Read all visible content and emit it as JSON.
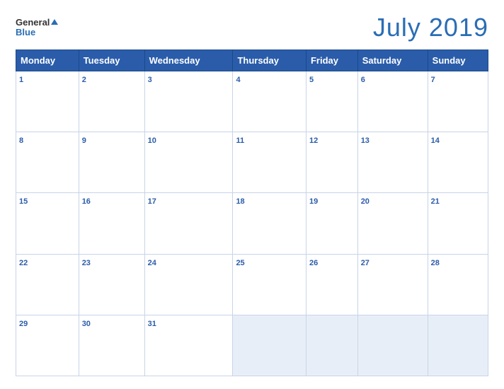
{
  "header": {
    "logo": {
      "general": "General",
      "blue": "Blue"
    },
    "title": "July 2019"
  },
  "calendar": {
    "days": [
      "Monday",
      "Tuesday",
      "Wednesday",
      "Thursday",
      "Friday",
      "Saturday",
      "Sunday"
    ],
    "weeks": [
      {
        "dates": [
          1,
          2,
          3,
          4,
          5,
          6,
          7
        ]
      },
      {
        "dates": [
          8,
          9,
          10,
          11,
          12,
          13,
          14
        ]
      },
      {
        "dates": [
          15,
          16,
          17,
          18,
          19,
          20,
          21
        ]
      },
      {
        "dates": [
          22,
          23,
          24,
          25,
          26,
          27,
          28
        ]
      },
      {
        "dates": [
          29,
          30,
          31,
          null,
          null,
          null,
          null
        ]
      }
    ]
  }
}
